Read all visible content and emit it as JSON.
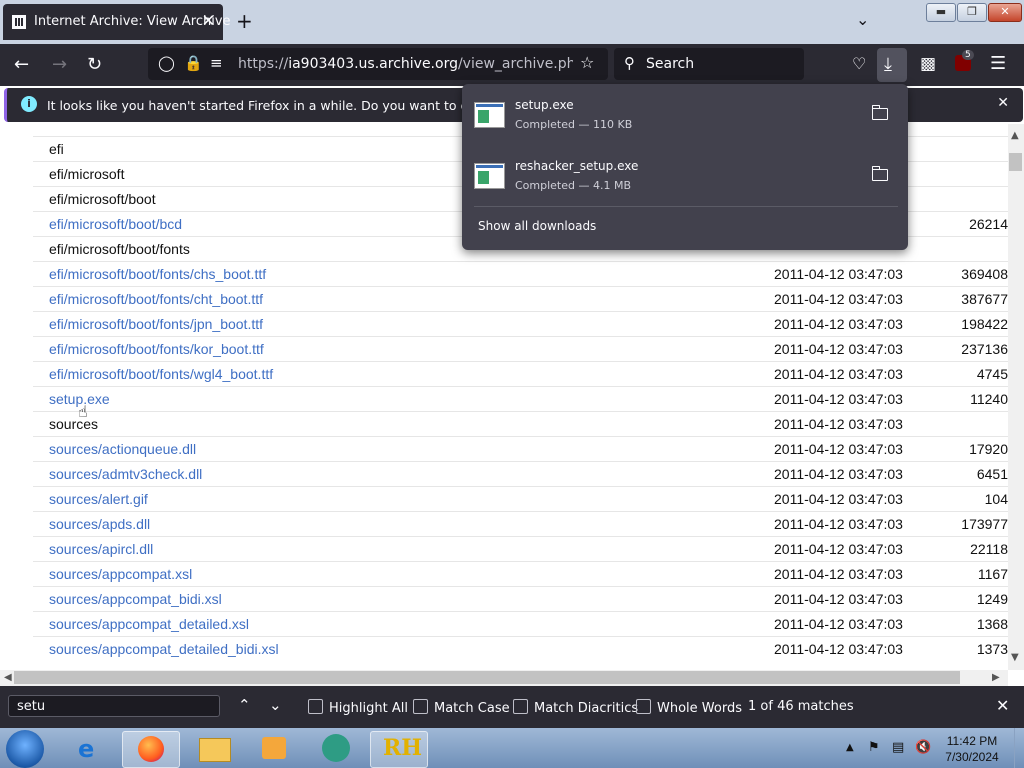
{
  "browser": {
    "tab_title": "Internet Archive: View Archive",
    "tab_close": "✕",
    "new_tab": "+",
    "url": "https://ia903403.us.archive.org/view_archive.php?archi",
    "url_host": "ia903403.us.archive.org",
    "url_prefix": "https://",
    "url_suffix": "/view_archive.php?archi",
    "search_placeholder": "Search",
    "extension_badge": "5"
  },
  "notification": {
    "message": "It looks like you haven't started Firefox in a while. Do you want to clean it up for"
  },
  "downloads": {
    "items": [
      {
        "name": "setup.exe",
        "status": "Completed — 110 KB"
      },
      {
        "name": "reshacker_setup.exe",
        "status": "Completed — 4.1 MB"
      }
    ],
    "show_all": "Show all downloads"
  },
  "files": [
    {
      "name": "efi",
      "link": false,
      "date": "",
      "size": ""
    },
    {
      "name": "efi/microsoft",
      "link": false,
      "date": "",
      "size": ""
    },
    {
      "name": "efi/microsoft/boot",
      "link": false,
      "date": "",
      "size": ""
    },
    {
      "name": "efi/microsoft/boot/bcd",
      "link": true,
      "date": "",
      "size": "26214"
    },
    {
      "name": "efi/microsoft/boot/fonts",
      "link": false,
      "date": "",
      "size": ""
    },
    {
      "name": "efi/microsoft/boot/fonts/chs_boot.ttf",
      "link": true,
      "date": "2011-04-12 03:47:03",
      "size": "369408"
    },
    {
      "name": "efi/microsoft/boot/fonts/cht_boot.ttf",
      "link": true,
      "date": "2011-04-12 03:47:03",
      "size": "387677"
    },
    {
      "name": "efi/microsoft/boot/fonts/jpn_boot.ttf",
      "link": true,
      "date": "2011-04-12 03:47:03",
      "size": "198422"
    },
    {
      "name": "efi/microsoft/boot/fonts/kor_boot.ttf",
      "link": true,
      "date": "2011-04-12 03:47:03",
      "size": "237136"
    },
    {
      "name": "efi/microsoft/boot/fonts/wgl4_boot.ttf",
      "link": true,
      "date": "2011-04-12 03:47:03",
      "size": "4745"
    },
    {
      "name": "setup.exe",
      "link": true,
      "date": "2011-04-12 03:47:03",
      "size": "11240"
    },
    {
      "name": "sources",
      "link": false,
      "date": "2011-04-12 03:47:03",
      "size": ""
    },
    {
      "name": "sources/actionqueue.dll",
      "link": true,
      "date": "2011-04-12 03:47:03",
      "size": "17920"
    },
    {
      "name": "sources/admtv3check.dll",
      "link": true,
      "date": "2011-04-12 03:47:03",
      "size": "6451"
    },
    {
      "name": "sources/alert.gif",
      "link": true,
      "date": "2011-04-12 03:47:03",
      "size": "104"
    },
    {
      "name": "sources/apds.dll",
      "link": true,
      "date": "2011-04-12 03:47:03",
      "size": "173977"
    },
    {
      "name": "sources/apircl.dll",
      "link": true,
      "date": "2011-04-12 03:47:03",
      "size": "22118"
    },
    {
      "name": "sources/appcompat.xsl",
      "link": true,
      "date": "2011-04-12 03:47:03",
      "size": "1167"
    },
    {
      "name": "sources/appcompat_bidi.xsl",
      "link": true,
      "date": "2011-04-12 03:47:03",
      "size": "1249"
    },
    {
      "name": "sources/appcompat_detailed.xsl",
      "link": true,
      "date": "2011-04-12 03:47:03",
      "size": "1368"
    },
    {
      "name": "sources/appcompat_detailed_bidi.xsl",
      "link": true,
      "date": "2011-04-12 03:47:03",
      "size": "1373"
    }
  ],
  "findbar": {
    "query": "setu",
    "highlight_all": "Highlight All",
    "match_case": "Match Case",
    "match_diacritics": "Match Diacritics",
    "whole_words": "Whole Words",
    "result": "1 of 46 matches"
  },
  "taskbar": {
    "time": "11:42 PM",
    "date": "7/30/2024"
  },
  "colors": {
    "accent": "#8f64e6",
    "link": "#3f6fc4",
    "chrome": "#2b2a33"
  }
}
